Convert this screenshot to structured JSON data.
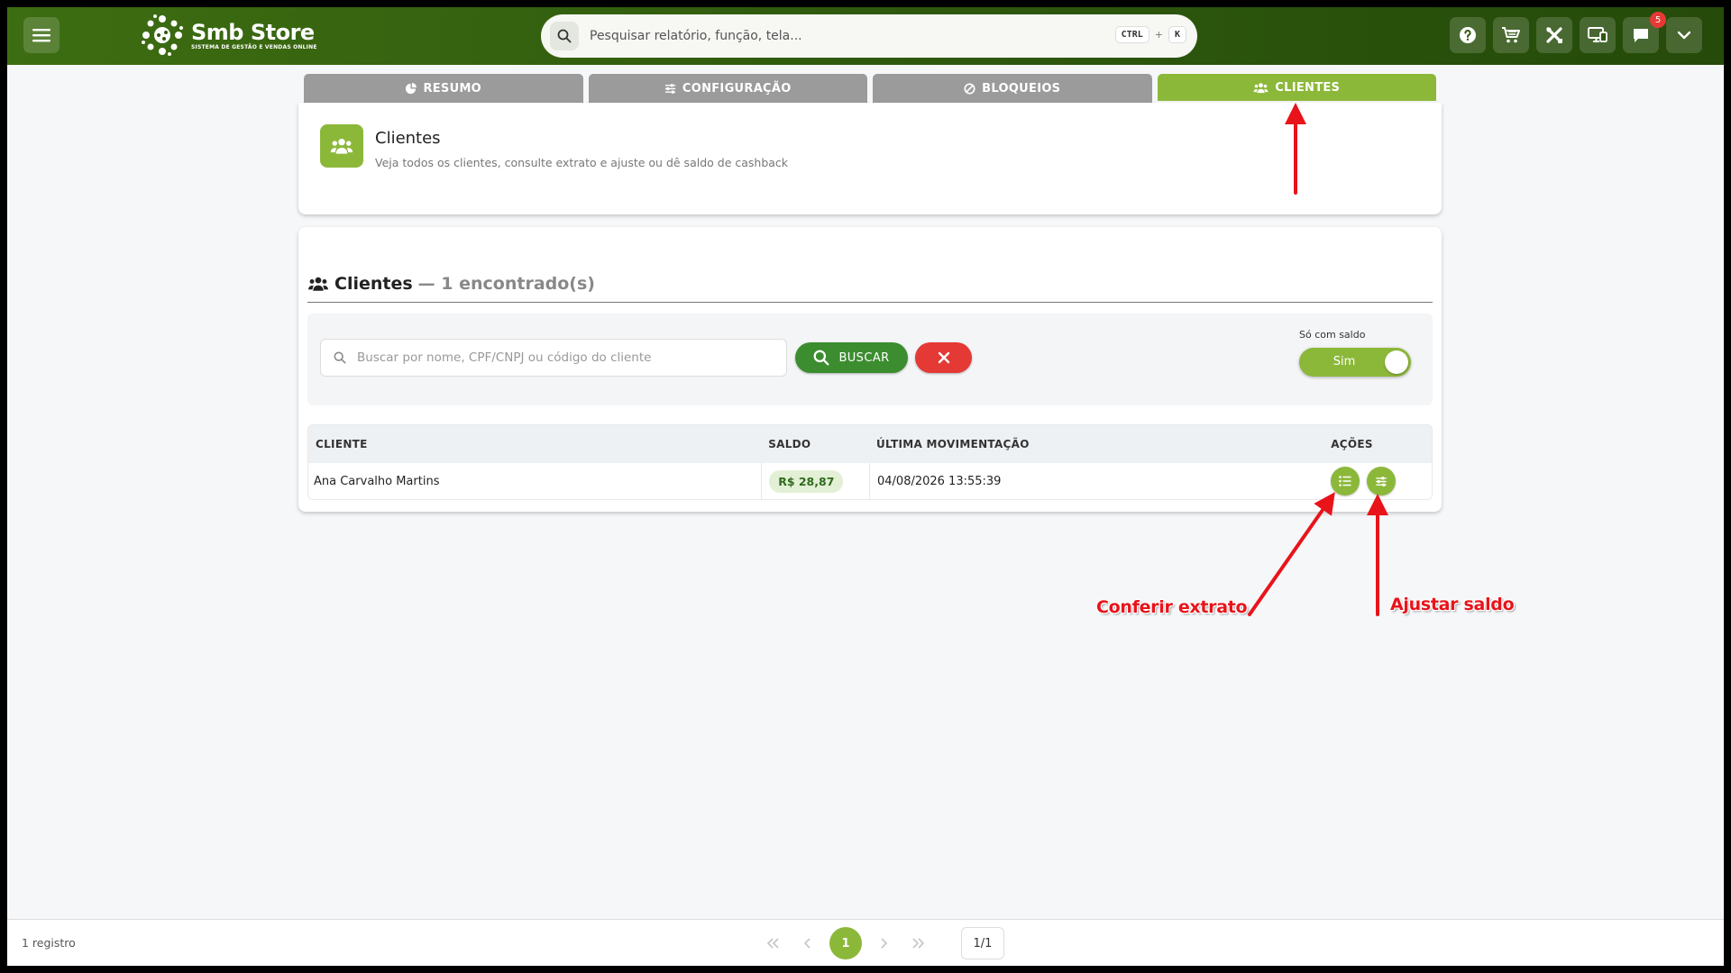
{
  "app": {
    "name": "Smb Store",
    "subtitle": "SISTEMA DE GESTÃO E VENDAS ONLINE"
  },
  "search": {
    "placeholder": "Pesquisar relatório, função, tela...",
    "shortcut_key1": "CTRL",
    "shortcut_plus": "+",
    "shortcut_key2": "K"
  },
  "notifications": {
    "count": "5"
  },
  "tabs": [
    {
      "label": "RESUMO",
      "icon": "pie-chart-icon",
      "active": false
    },
    {
      "label": "CONFIGURAÇÃO",
      "icon": "sliders-icon",
      "active": false
    },
    {
      "label": "BLOQUEIOS",
      "icon": "block-icon",
      "active": false
    },
    {
      "label": "CLIENTES",
      "icon": "users-icon",
      "active": true
    }
  ],
  "header": {
    "title": "Clientes",
    "description": "Veja todos os clientes, consulte extrato e ajuste ou dê saldo de cashback"
  },
  "list": {
    "title": "Clientes",
    "count_text": "— 1 encontrado(s)",
    "search_placeholder": "Buscar por nome, CPF/CNPJ ou código do cliente",
    "buscar_label": "BUSCAR",
    "toggle_label": "Só com saldo",
    "toggle_value": "Sim"
  },
  "table": {
    "columns": [
      "CLIENTE",
      "SALDO",
      "ÚLTIMA MOVIMENTAÇÃO",
      "AÇÕES"
    ],
    "rows": [
      {
        "cliente": "Ana Carvalho Martins",
        "saldo": "R$ 28,87",
        "ultima": "04/08/2026 13:55:39"
      }
    ]
  },
  "annotations": {
    "extrato": "Conferir extrato",
    "ajustar": "Ajustar saldo"
  },
  "footer": {
    "count": "1 registro",
    "current_page": "1",
    "page_of": "1/1"
  },
  "colors": {
    "brand_green": "#8cb83a",
    "topbar_green": "#2f5a0d",
    "buscar_green": "#3c8d2f",
    "danger_red": "#e53935",
    "annotation_red": "#e8141a"
  }
}
